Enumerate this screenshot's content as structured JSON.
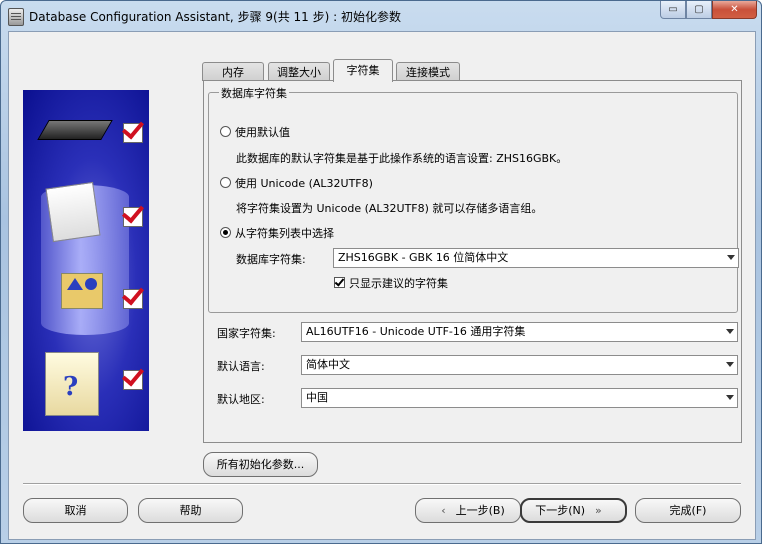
{
  "window": {
    "title": "Database Configuration Assistant, 步骤 9(共 11 步) : 初始化参数",
    "minimize_glyph": "▭",
    "maximize_glyph": "▢",
    "close_glyph": "✕"
  },
  "tabs": [
    {
      "label": "内存",
      "active": false
    },
    {
      "label": "调整大小",
      "active": false
    },
    {
      "label": "字符集",
      "active": true
    },
    {
      "label": "连接模式",
      "active": false
    }
  ],
  "charset_group": {
    "legend": "数据库字符集",
    "option_default": {
      "label": "使用默认值",
      "selected": false,
      "desc": "此数据库的默认字符集是基于此操作系统的语言设置: ZHS16GBK。"
    },
    "option_unicode": {
      "label": "使用 Unicode (AL32UTF8)",
      "selected": false,
      "desc": "将字符集设置为 Unicode (AL32UTF8) 就可以存储多语言组。"
    },
    "option_list": {
      "label": "从字符集列表中选择",
      "selected": true
    },
    "db_charset_label": "数据库字符集:",
    "db_charset_value": "ZHS16GBK - GBK 16 位简体中文",
    "show_recommended_label": "只显示建议的字符集",
    "show_recommended_checked": true
  },
  "national_charset": {
    "label": "国家字符集:",
    "value": "AL16UTF16 - Unicode UTF-16 通用字符集"
  },
  "default_language": {
    "label": "默认语言:",
    "value": "简体中文"
  },
  "default_territory": {
    "label": "默认地区:",
    "value": "中国"
  },
  "all_params_button": "所有初始化参数...",
  "buttons": {
    "cancel": "取消",
    "help": "帮助",
    "back": "上一步(B)",
    "next": "下一步(N)",
    "finish": "完成(F)"
  },
  "icons": {
    "back_arrow": "‹",
    "next_arrow": "»"
  }
}
